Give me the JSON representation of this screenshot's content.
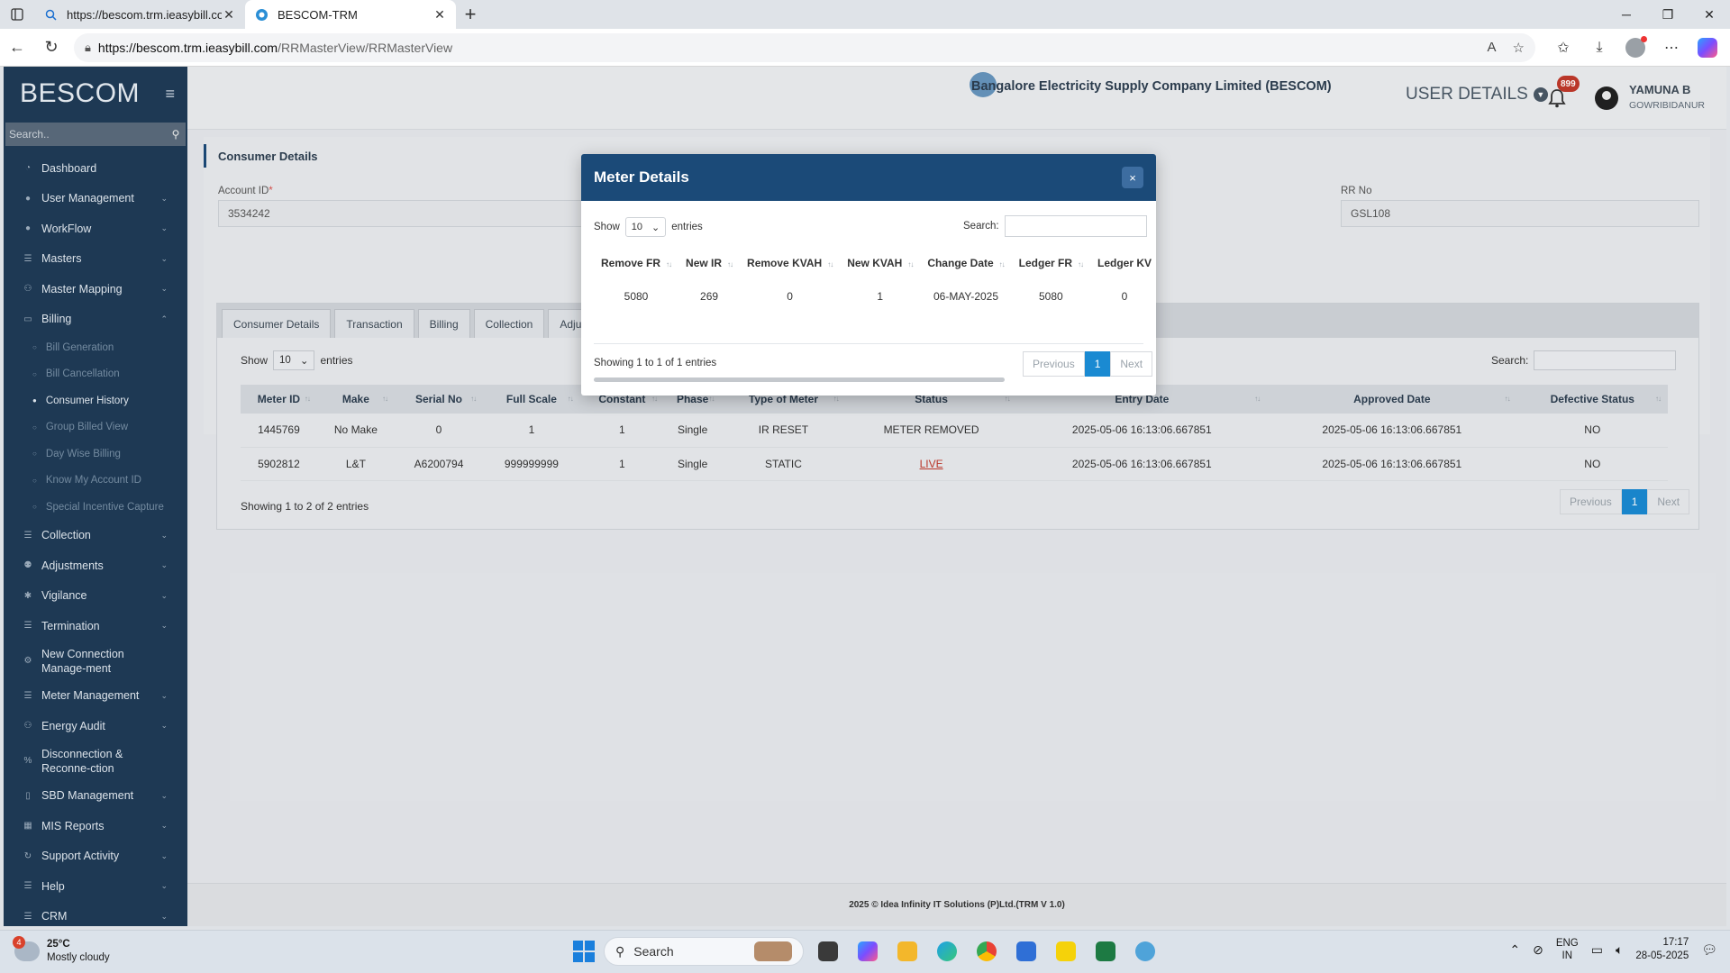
{
  "browser": {
    "tabs": [
      {
        "title": "https://bescom.trm.ieasybill.com/",
        "active": false
      },
      {
        "title": "BESCOM-TRM",
        "active": true
      }
    ],
    "url_host": "https://bescom.trm.ieasybill.com",
    "url_path": "/RRMasterView/RRMasterView"
  },
  "sidebar": {
    "brand": "BESCOM",
    "search_placeholder": "Search..",
    "items": [
      {
        "label": "Dashboard",
        "icon": "dashboard-icon"
      },
      {
        "label": "User Management",
        "icon": "user-icon"
      },
      {
        "label": "WorkFlow",
        "icon": "workflow-icon"
      },
      {
        "label": "Masters",
        "icon": "list-icon"
      },
      {
        "label": "Master Mapping",
        "icon": "mapping-icon"
      },
      {
        "label": "Billing",
        "icon": "monitor-icon",
        "expanded": true
      },
      {
        "label": "Collection",
        "icon": "list-icon"
      },
      {
        "label": "Adjustments",
        "icon": "users-icon"
      },
      {
        "label": "Vigilance",
        "icon": "vigilance-icon"
      },
      {
        "label": "Termination",
        "icon": "list-icon"
      },
      {
        "label": "New Connection Manage-ment",
        "icon": "gear-icon"
      },
      {
        "label": "Meter Management",
        "icon": "list-icon"
      },
      {
        "label": "Energy Audit",
        "icon": "audit-icon"
      },
      {
        "label": "Disconnection & Reconne-ction",
        "icon": "link-icon"
      },
      {
        "label": "SBD Management",
        "icon": "box-icon"
      },
      {
        "label": "MIS Reports",
        "icon": "chart-icon"
      },
      {
        "label": "Support Activity",
        "icon": "support-icon"
      },
      {
        "label": "Help",
        "icon": "help-icon"
      },
      {
        "label": "CRM",
        "icon": "crm-icon"
      }
    ],
    "billing_sub": [
      "Bill Generation",
      "Bill Cancellation",
      "Consumer History",
      "Group Billed View",
      "Day Wise Billing",
      "Know My Account ID",
      "Special Incentive Capture"
    ]
  },
  "header": {
    "company": "Bangalore Electricity Supply Company Limited (BESCOM)",
    "user_details": "USER DETAILS",
    "notif_count": "899",
    "user_name": "YAMUNA B",
    "user_location": "GOWRIBIDANUR"
  },
  "consumer": {
    "title": "Consumer Details",
    "account_label": "Account ID",
    "account_value": "3534242",
    "rr_label": "RR No",
    "rr_value": "GSL108"
  },
  "tabs": [
    "Consumer Details",
    "Transaction",
    "Billing",
    "Collection",
    "Adjustment"
  ],
  "meter_table": {
    "show": "Show",
    "entries_count": "10",
    "entries": "entries",
    "search_label": "Search:",
    "columns": [
      "Meter ID",
      "Make",
      "Serial No",
      "Full Scale",
      "Constant",
      "Phase",
      "Type of Meter",
      "Status",
      "Entry Date",
      "Approved Date",
      "Defective Status"
    ],
    "rows": [
      [
        "1445769",
        "No Make",
        "0",
        "1",
        "1",
        "Single",
        "IR RESET",
        "METER REMOVED",
        "2025-05-06 16:13:06.667851",
        "2025-05-06 16:13:06.667851",
        "NO"
      ],
      [
        "5902812",
        "L&T",
        "A6200794",
        "999999999",
        "1",
        "Single",
        "STATIC",
        "LIVE",
        "2025-05-06 16:13:06.667851",
        "2025-05-06 16:13:06.667851",
        "NO"
      ]
    ],
    "info": "Showing 1 to 2 of 2 entries",
    "prev": "Previous",
    "page": "1",
    "next": "Next"
  },
  "footer": "2025 © Idea Infinity IT Solutions (P)Ltd.(TRM V 1.0)",
  "modal": {
    "title": "Meter Details",
    "close": "×",
    "show": "Show",
    "entries_count": "10",
    "entries": "entries",
    "search_label": "Search:",
    "columns": [
      "Remove FR",
      "New IR",
      "Remove KVAH",
      "New KVAH",
      "Change Date",
      "Ledger FR",
      "Ledger KV"
    ],
    "rows": [
      [
        "5080",
        "269",
        "0",
        "1",
        "06-MAY-2025",
        "5080",
        "0"
      ]
    ],
    "info": "Showing 1 to 1 of 1 entries",
    "prev": "Previous",
    "page": "1",
    "next": "Next"
  },
  "taskbar": {
    "weather_badge": "4",
    "temp": "25°C",
    "condition": "Mostly cloudy",
    "search": "Search",
    "lang1": "ENG",
    "lang2": "IN",
    "time": "17:17",
    "date": "28-05-2025"
  },
  "colors": {
    "sidebar_bg": "#1f3b57",
    "modal_header": "#1b4a78",
    "accent": "#1a8ad2",
    "live": "#c0392b"
  }
}
